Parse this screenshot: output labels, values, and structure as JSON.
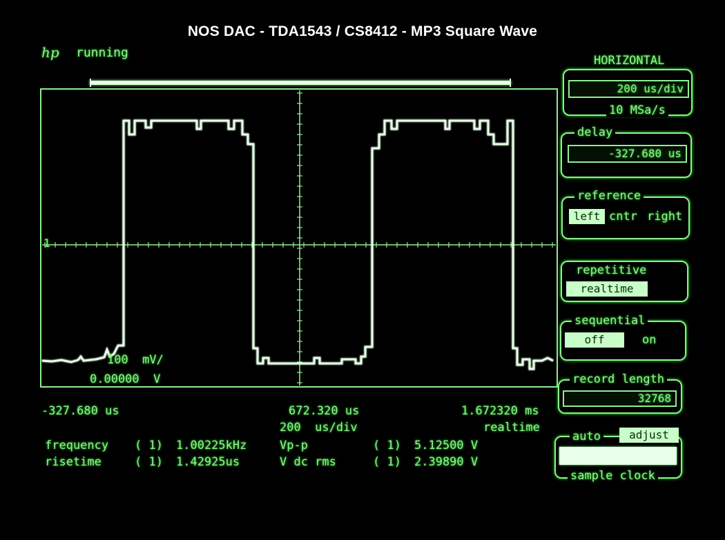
{
  "title": "NOS DAC - TDA1543 / CS8412 - MP3 Square Wave",
  "header": {
    "logo": "hp",
    "status": "running"
  },
  "scope": {
    "channel_marker": "1",
    "scale_label": "100  mV/",
    "offset_label": "0.00000  V",
    "time_left": "-327.680 us",
    "time_center": "672.320 us",
    "time_right": "1.672320 ms",
    "timebase": "200  us/div",
    "mode": "realtime"
  },
  "measurements": [
    {
      "name": "frequency",
      "channel": "( 1)",
      "value": "1.00225kHz"
    },
    {
      "name": "risetime",
      "channel": "( 1)",
      "value": "1.42925us"
    },
    {
      "name": "Vp-p",
      "channel": "( 1)",
      "value": "5.12500 V"
    },
    {
      "name": "V dc rms",
      "channel": "( 1)",
      "value": "2.39890 V"
    }
  ],
  "panel": {
    "horizontal_title": "HORIZONTAL",
    "timebase_value": "200  us/div",
    "sample_rate": "10 MSa/s",
    "delay_title": "delay",
    "delay_value": "-327.680 us",
    "reference_title": "reference",
    "reference_options": [
      "left",
      "cntr",
      "right"
    ],
    "repetitive_title": "repetitive",
    "repetitive_value": "realtime",
    "sequential_title": "sequential",
    "sequential_options": [
      "off",
      "on"
    ],
    "record_length_title": "record length",
    "record_length_value": "32768",
    "auto_label": "auto",
    "adjust_label": "adjust",
    "sample_clock_title": "sample clock"
  },
  "colors": {
    "phosphor": "#8ff08f",
    "trace": "#e6ffe6",
    "background": "#000000",
    "title_text": "#ffffff"
  }
}
